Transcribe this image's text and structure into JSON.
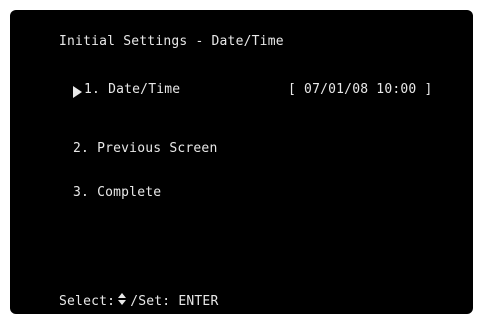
{
  "screen": {
    "title": "Initial Settings - Date/Time",
    "menu": {
      "item1": {
        "label": "1. Date/Time",
        "value": "[ 07/01/08 10:00 ]",
        "selected": true
      },
      "item2": {
        "label": "2. Previous Screen"
      },
      "item3": {
        "label": "3. Complete"
      }
    },
    "footer": {
      "select_label": "Select:",
      "select_icon": "up-down-arrows-icon",
      "set_label": "/Set: ENTER"
    }
  },
  "colors": {
    "background": "#000000",
    "text": "#e8e8e8",
    "frame": "#ffffff"
  },
  "icons": {
    "cursor": "right-triangle-cursor-icon"
  }
}
